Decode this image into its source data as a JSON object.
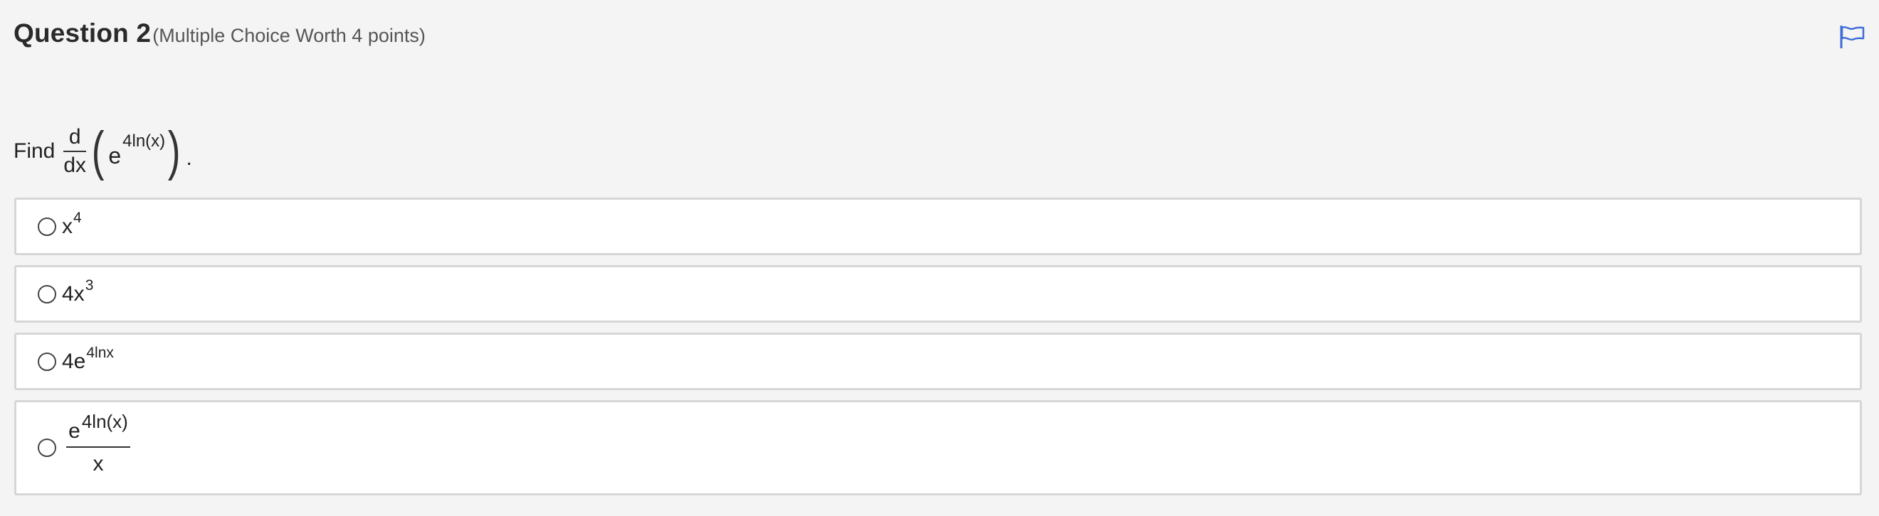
{
  "question": {
    "title": "Question 2",
    "worth": "(Multiple Choice Worth 4 points)"
  },
  "flag": {
    "icon": "flag-icon",
    "color": "#3f6dd6"
  },
  "prompt": {
    "text": "Find",
    "deriv_num": "d",
    "deriv_den": "dx",
    "base": "e",
    "exponent": "4ln(x)",
    "end": "."
  },
  "options": [
    {
      "base": "x",
      "exp": "4"
    },
    {
      "base": "4x",
      "exp": "3"
    },
    {
      "base": "4e",
      "exp": "4lnx"
    },
    {
      "num_base": "e",
      "num_exp": "4ln(x)",
      "den": "x"
    }
  ]
}
